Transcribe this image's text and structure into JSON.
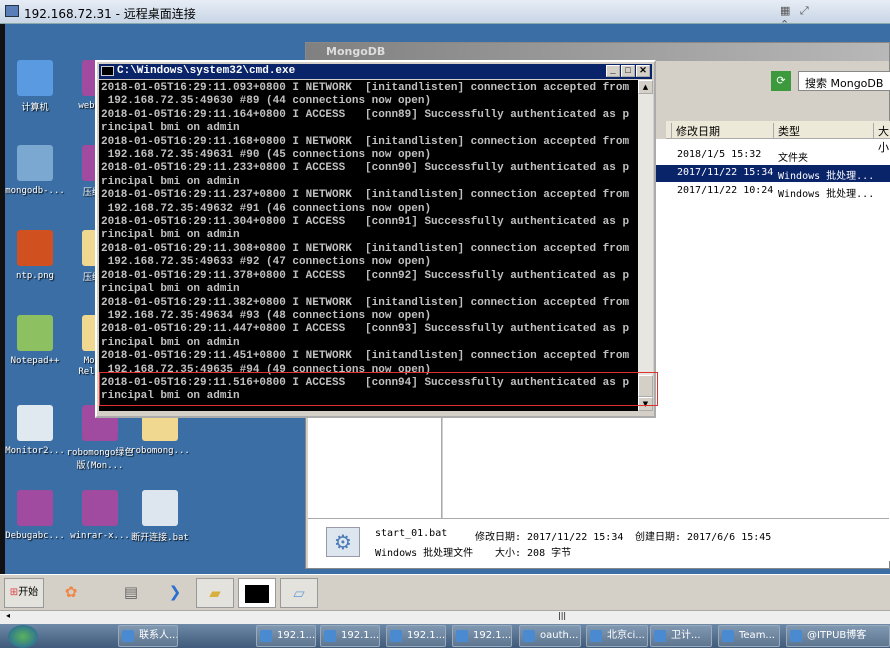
{
  "rdp": {
    "title": "192.168.72.31 - 远程桌面连接",
    "controls": "▦ ⤢ ⌃"
  },
  "desktop_icons": [
    {
      "label": "计算机",
      "icon": "computer-icon"
    },
    {
      "label": "webto...",
      "icon": "winrar-icon"
    },
    {
      "label": "mongodb-...",
      "icon": "installer-icon"
    },
    {
      "label": "压缩...",
      "icon": "winrar-icon"
    },
    {
      "label": "ntp.png",
      "icon": "image-icon"
    },
    {
      "label": "压缩...",
      "icon": "folder-icon"
    },
    {
      "label": "Notepad++",
      "icon": "notepad-icon"
    },
    {
      "label": "Mon... Relea...",
      "icon": "folder-icon"
    },
    {
      "label": "Monitor2...",
      "icon": "app-icon"
    },
    {
      "label": "robomongo绿色版(Mon...",
      "icon": "winrar-icon"
    },
    {
      "label": "robomong...",
      "icon": "folder-icon"
    },
    {
      "label": "Debugabc...",
      "icon": "winrar-icon"
    },
    {
      "label": "winrar-x...",
      "icon": "winrar-icon"
    },
    {
      "label": "断开连接.bat",
      "icon": "gear-icon"
    }
  ],
  "explorer": {
    "title": "MongoDB",
    "search_placeholder": "搜索 MongoDB",
    "columns": [
      "修改日期",
      "类型",
      "大小"
    ],
    "rows": [
      {
        "date": "2018/1/5 15:32",
        "type": "文件夹",
        "selected": false
      },
      {
        "date": "2017/11/22 15:34",
        "type": "Windows 批处理...",
        "selected": true
      },
      {
        "date": "2017/11/22 10:24",
        "type": "Windows 批处理...",
        "selected": false
      }
    ],
    "details": {
      "name": "start_01.bat",
      "type": "Windows 批处理文件",
      "modified": "修改日期: 2017/11/22 15:34",
      "created": "创建日期: 2017/6/6 15:45",
      "size": "大小: 208 字节"
    }
  },
  "cmd": {
    "title": "C:\\Windows\\system32\\cmd.exe",
    "lines": [
      "2018-01-05T16:29:11.093+0800 I NETWORK  [initandlisten] connection accepted from",
      " 192.168.72.35:49630 #89 (44 connections now open)",
      "2018-01-05T16:29:11.164+0800 I ACCESS   [conn89] Successfully authenticated as p",
      "rincipal bmi on admin",
      "2018-01-05T16:29:11.168+0800 I NETWORK  [initandlisten] connection accepted from",
      " 192.168.72.35:49631 #90 (45 connections now open)",
      "2018-01-05T16:29:11.233+0800 I ACCESS   [conn90] Successfully authenticated as p",
      "rincipal bmi on admin",
      "2018-01-05T16:29:11.237+0800 I NETWORK  [initandlisten] connection accepted from",
      " 192.168.72.35:49632 #91 (46 connections now open)",
      "2018-01-05T16:29:11.304+0800 I ACCESS   [conn91] Successfully authenticated as p",
      "rincipal bmi on admin",
      "2018-01-05T16:29:11.308+0800 I NETWORK  [initandlisten] connection accepted from",
      " 192.168.72.35:49633 #92 (47 connections now open)",
      "2018-01-05T16:29:11.378+0800 I ACCESS   [conn92] Successfully authenticated as p",
      "rincipal bmi on admin",
      "2018-01-05T16:29:11.382+0800 I NETWORK  [initandlisten] connection accepted from",
      " 192.168.72.35:49634 #93 (48 connections now open)",
      "2018-01-05T16:29:11.447+0800 I ACCESS   [conn93] Successfully authenticated as p",
      "rincipal bmi on admin",
      "2018-01-05T16:29:11.451+0800 I NETWORK  [initandlisten] connection accepted from",
      " 192.168.72.35:49635 #94 (49 connections now open)",
      "2018-01-05T16:29:11.516+0800 I ACCESS   [conn94] Successfully authenticated as p",
      "rincipal bmi on admin"
    ],
    "highlight_color": "#e03030"
  },
  "remote_toolbar": {
    "start": "开始"
  },
  "taskbar": {
    "items": [
      "联系人...",
      "192.1...",
      "192.1...",
      "192.1...",
      "192.1...",
      "oauth...",
      "北京ci...",
      "卫计...",
      "Team...",
      "@ITPUB博客"
    ]
  }
}
